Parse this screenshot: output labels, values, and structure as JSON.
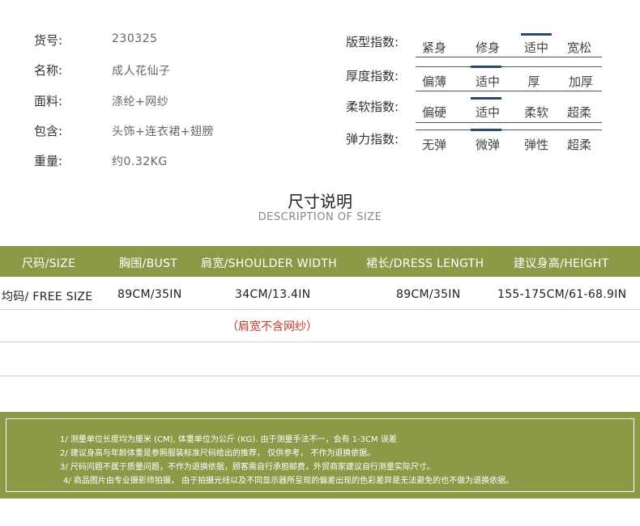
{
  "product_info": [
    {
      "label": "货号:",
      "value": "230325"
    },
    {
      "label": "名称:",
      "value": "成人花仙子"
    },
    {
      "label": "面料:",
      "value": "涤纶+网纱"
    },
    {
      "label": "包含:",
      "value": "头饰+连衣裙+翅膀"
    },
    {
      "label": "重量:",
      "value": "约0.32KG"
    }
  ],
  "indices": [
    {
      "label": "版型指数:",
      "options": [
        "紧身",
        "修身",
        "适中",
        "宽松"
      ],
      "selected": "适中"
    },
    {
      "label": "厚度指数:",
      "options": [
        "偏薄",
        "适中",
        "厚",
        "加厚"
      ],
      "selected": "适中"
    },
    {
      "label": "柔软指数:",
      "options": [
        "偏硬",
        "适中",
        "柔软",
        "超柔"
      ],
      "selected": "适中"
    },
    {
      "label": "弹力指数:",
      "options": [
        "无弹",
        "微弹",
        "弹性",
        "超柔"
      ],
      "selected": "微弹"
    }
  ],
  "size_section": {
    "title_cn": "尺寸说明",
    "title_en": "DESCRIPTION OF SIZE",
    "headers": [
      "尺码/SIZE",
      "胸围/BUST",
      "肩宽/SHOULDER WIDTH",
      "裙长/DRESS LENGTH",
      "建议身高/HEIGHT"
    ],
    "rows": [
      [
        "均码/ FREE SIZE",
        "89CM/35IN",
        "34CM/13.4IN",
        "89CM/35IN",
        "155-175CM/61-68.9IN"
      ]
    ],
    "remark": "（肩宽不含网纱）"
  },
  "notes": [
    "1/ 测量单位长度均为厘米 (CM), 体重单位为公斤 (KG). 由于测量手法不一，会有 1-3CM 误差",
    "2/ 建议身高与年龄体重是参照服装标准尺码给出的推荐，  仅供参考，  不作为退换依据。",
    "3/ 尺码问题不属于质量问题，不作为退换依据，顾客需自行承担邮费，外贸商家建议自行测量实际尺寸。",
    "4/ 商品图片由专业摄影师拍摄，  由于拍摄光线以及不同显示器所呈现的偏差出现的色彩差异是无法避免的也不做为退换依据。"
  ],
  "colors": {
    "accent_green": "#8a9a47",
    "marker_blue": "#2d4a6e",
    "remark_red": "#c0392b"
  }
}
